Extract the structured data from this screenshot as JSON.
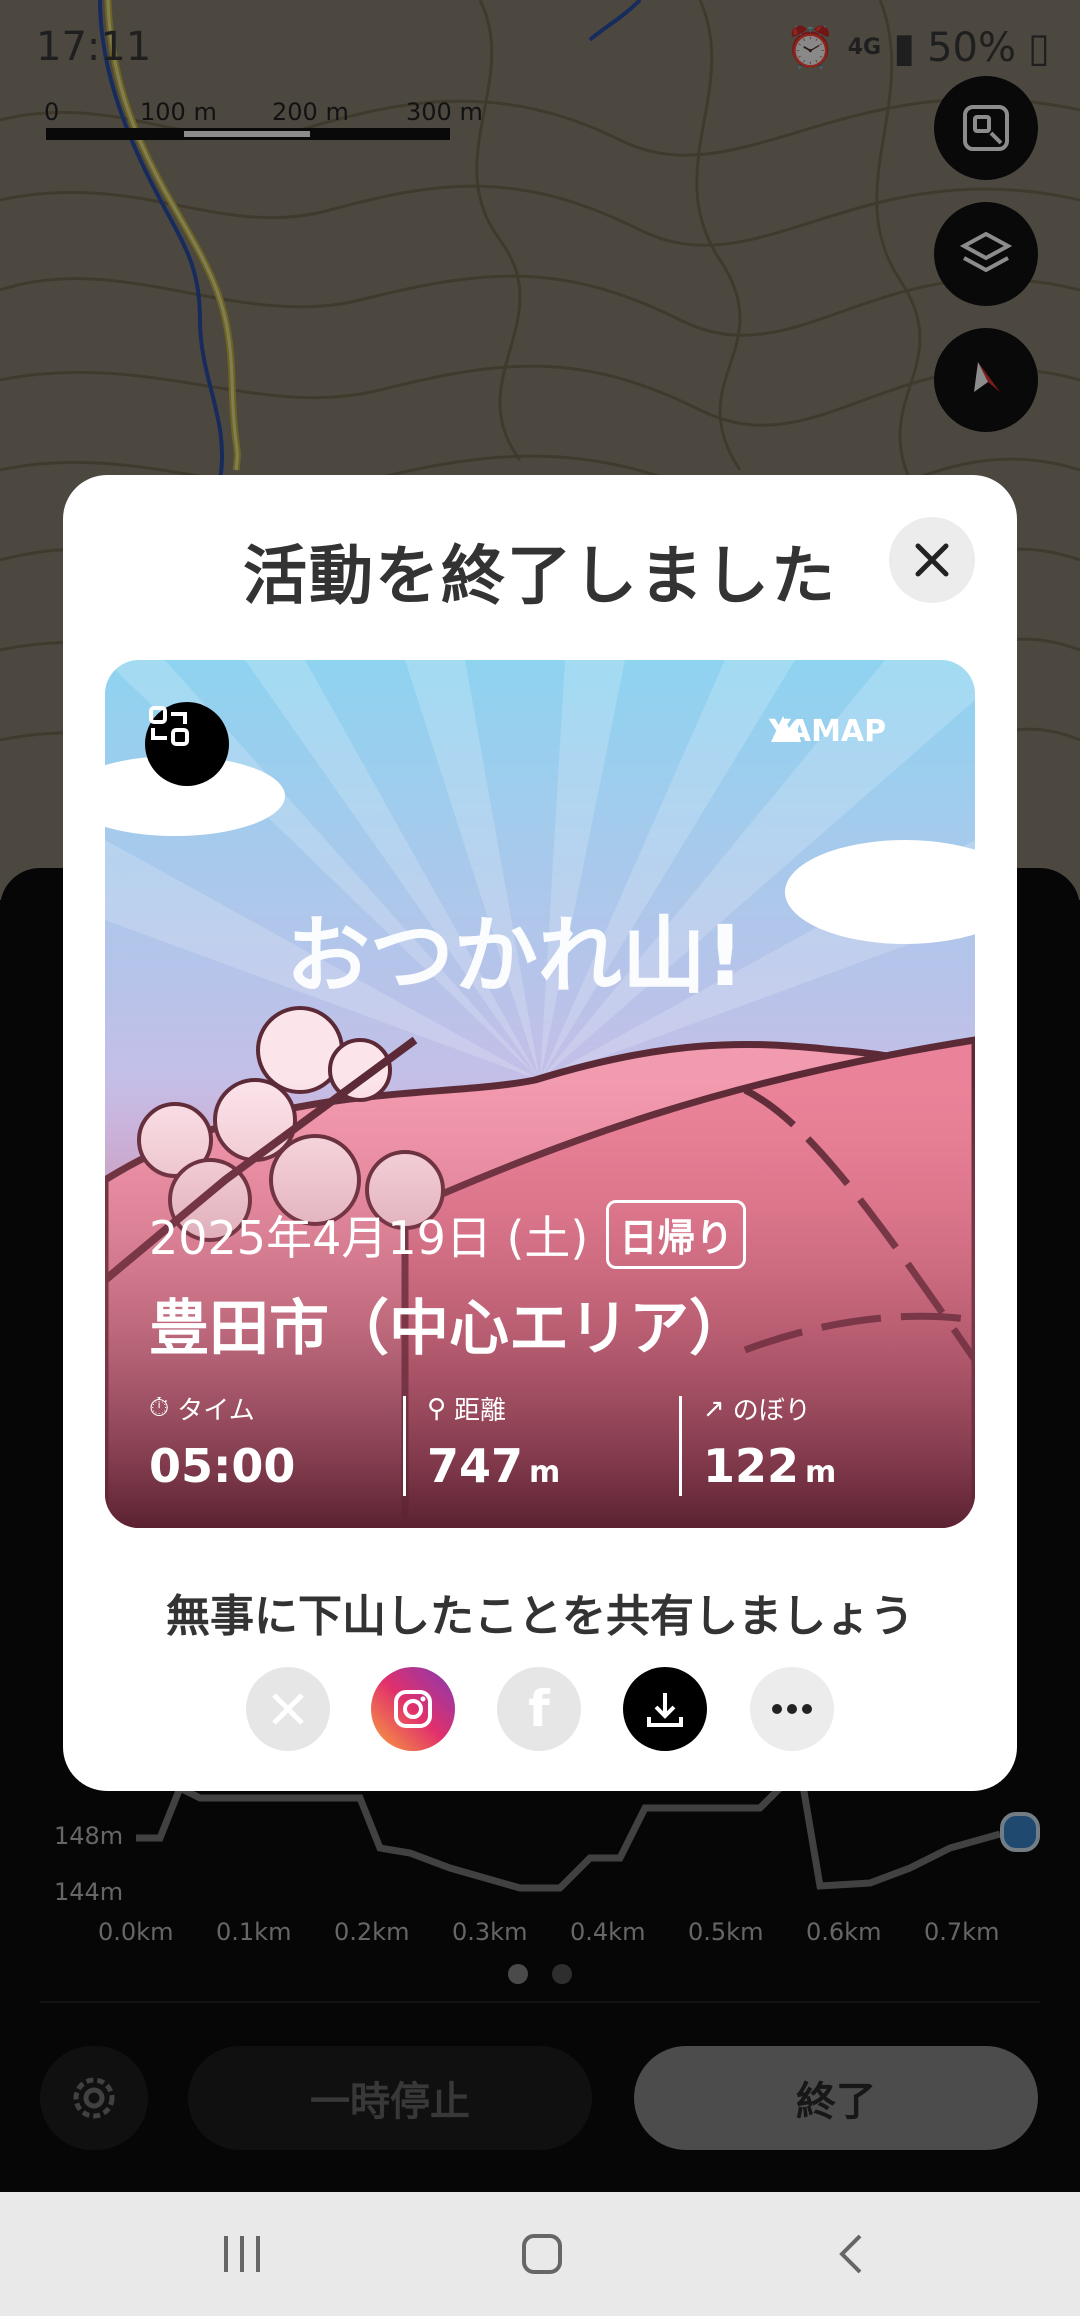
{
  "status_bar": {
    "time": "17:11",
    "network": "4G",
    "battery": "50%"
  },
  "map": {
    "scale_labels": [
      "0",
      "100 m",
      "200 m",
      "300 m"
    ]
  },
  "modal": {
    "title": "活動を終了しました",
    "card": {
      "brand": "YAMAP",
      "headline": "おつかれ山!",
      "date": "2025年4月19日 (土)",
      "trip_type": "日帰り",
      "place": "豊田市（中心エリア）",
      "stats": [
        {
          "label": "タイム",
          "value": "05:00",
          "unit": ""
        },
        {
          "label": "距離",
          "value": "747",
          "unit": "m"
        },
        {
          "label": "のぼり",
          "value": "122",
          "unit": "m"
        }
      ]
    },
    "share_prompt": "無事に下山したことを共有しましょう",
    "share_icons": [
      "x-icon",
      "instagram-icon",
      "facebook-icon",
      "download-icon",
      "more-icon"
    ]
  },
  "chart": {
    "y_ticks": [
      "148m",
      "144m"
    ],
    "x_ticks": [
      "0.0km",
      "0.1km",
      "0.2km",
      "0.3km",
      "0.4km",
      "0.5km",
      "0.6km",
      "0.7km"
    ]
  },
  "controls": {
    "pause_label": "一時停止",
    "end_label": "終了"
  },
  "colors": {
    "accent_blue": "#3a86c8",
    "card_pink": "#e58a9c",
    "dark_panel": "#0b0b0b"
  }
}
